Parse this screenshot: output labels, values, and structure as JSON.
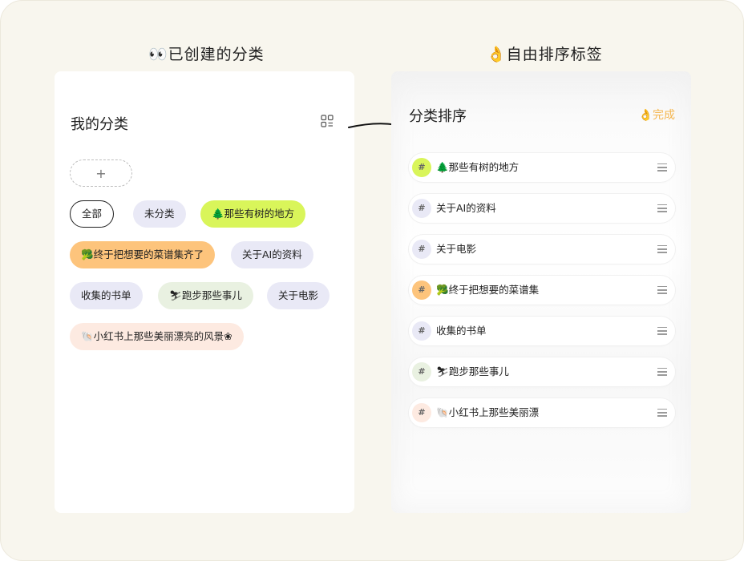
{
  "headings": {
    "left": "👀已创建的分类",
    "right": "👌自由排序标签"
  },
  "left_panel": {
    "title": "我的分类",
    "add_label": "+",
    "chips": [
      {
        "label": "全部",
        "style": "outline"
      },
      {
        "label": "未分类",
        "style": "lav"
      },
      {
        "label": "🌲那些有树的地方",
        "style": "lime"
      },
      {
        "label": "🥦终于把想要的菜谱集齐了",
        "style": "orange"
      },
      {
        "label": "关于AI的资料",
        "style": "lav"
      },
      {
        "label": "收集的书单",
        "style": "lav"
      },
      {
        "label": "⛷跑步那些事儿",
        "style": "mint"
      },
      {
        "label": "关于电影",
        "style": "lav"
      },
      {
        "label": "🐚小红书上那些美丽漂亮的风景❀",
        "style": "peach"
      }
    ]
  },
  "right_panel": {
    "title": "分类排序",
    "done_label": "👌完成",
    "hash_symbol": "#",
    "items": [
      {
        "label": "🌲那些有树的地方",
        "style": "lime"
      },
      {
        "label": "关于AI的资料",
        "style": "lav"
      },
      {
        "label": "关于电影",
        "style": "lav"
      },
      {
        "label": "🥦终于把想要的菜谱集",
        "style": "orange"
      },
      {
        "label": "收集的书单",
        "style": "lav"
      },
      {
        "label": "⛷跑步那些事儿",
        "style": "mint"
      },
      {
        "label": "🐚小红书上那些美丽漂",
        "style": "peach"
      }
    ]
  },
  "colors": {
    "background": "#f8f6ee",
    "lime": "#d9f55a",
    "orange": "#fdc47c",
    "lavender": "#e9e9f6",
    "mint": "#e9f1e1",
    "peach": "#fdeae1",
    "done_accent": "#f5b64f"
  }
}
